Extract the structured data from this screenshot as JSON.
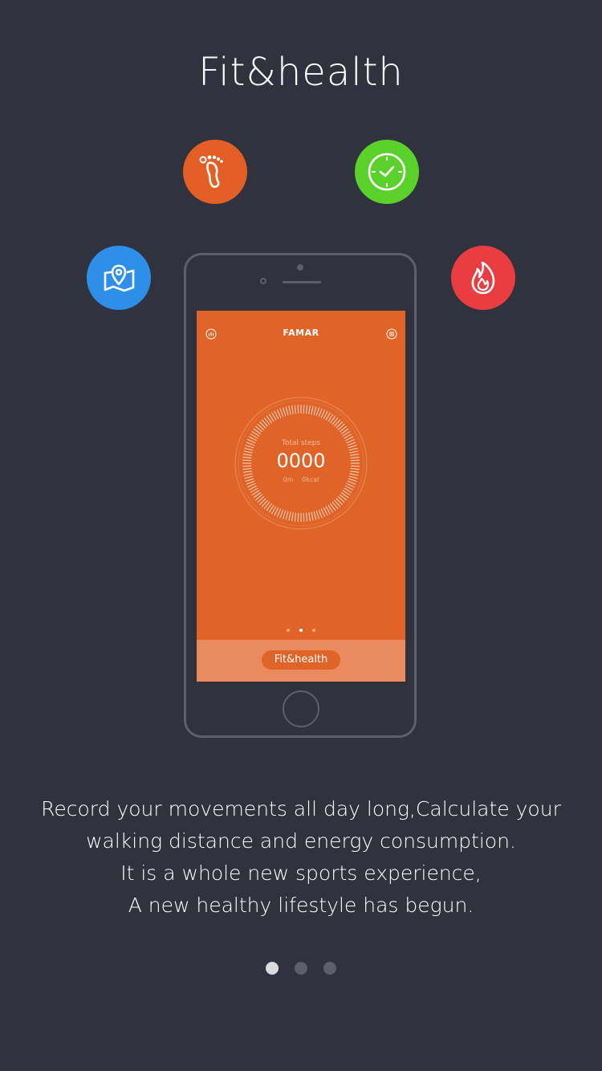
{
  "title": "Fit&health",
  "features": [
    {
      "icon": "footprint-icon",
      "color": "#e35f25"
    },
    {
      "icon": "clock-icon",
      "color": "#5bd12c"
    },
    {
      "icon": "map-location-icon",
      "color": "#2d8fe7"
    },
    {
      "icon": "flame-icon",
      "color": "#ea3d41"
    }
  ],
  "phone": {
    "app_title": "FAMAR",
    "left_icon": "chart-icon",
    "right_icon": "menu-icon",
    "steps_label": "Total steps",
    "steps_value": "0000",
    "distance": "0m",
    "calories": "0kcal",
    "carousel_active": 2,
    "footer_button": "Fit&health",
    "accent": "#e06427"
  },
  "description": [
    "Record your movements all day long,Calculate your",
    "walking distance and energy consumption.",
    "It is a whole new sports experience,",
    "A new healthy lifestyle has begun."
  ],
  "pager": {
    "active": 1,
    "total": 3
  }
}
